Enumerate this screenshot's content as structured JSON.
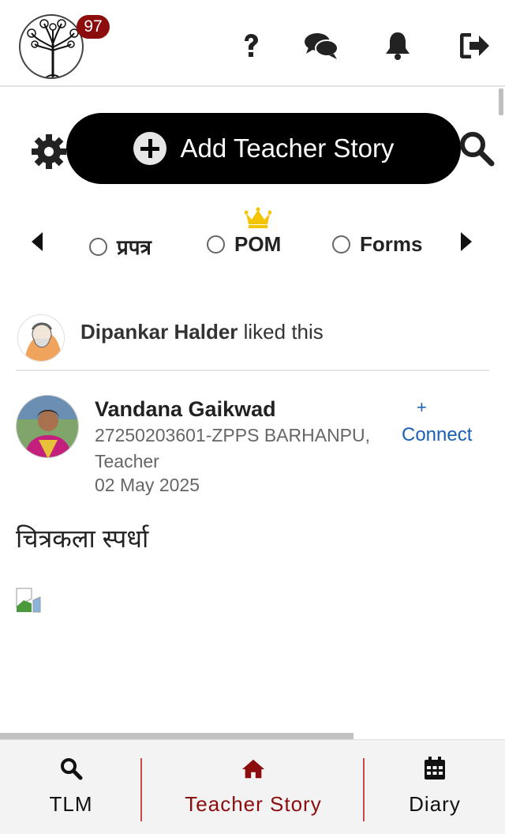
{
  "header": {
    "notification_count": "97",
    "icons": [
      "help-icon",
      "chat-icon",
      "bell-icon",
      "logout-icon"
    ]
  },
  "actions": {
    "add_story_label": "Add Teacher Story"
  },
  "filters": {
    "options": [
      "प्रपत्र",
      "POM",
      "Forms"
    ]
  },
  "activity": {
    "liker_name": "Dipankar Halder",
    "liked_suffix": " liked this"
  },
  "post": {
    "author_name": "Vandana Gaikwad",
    "school": "27250203601-ZPPS BARHANPU,",
    "role": "Teacher",
    "date": "02 May 2025",
    "connect_plus": "+",
    "connect_label": "Connect",
    "title": "चित्रकला स्पर्धा"
  },
  "bottom_nav": {
    "items": [
      "TLM",
      "Teacher Story",
      "Diary"
    ],
    "active": "Teacher Story"
  },
  "colors": {
    "accent": "#8b0d0d",
    "link": "#1b5fb4",
    "crown": "#f5c400"
  }
}
